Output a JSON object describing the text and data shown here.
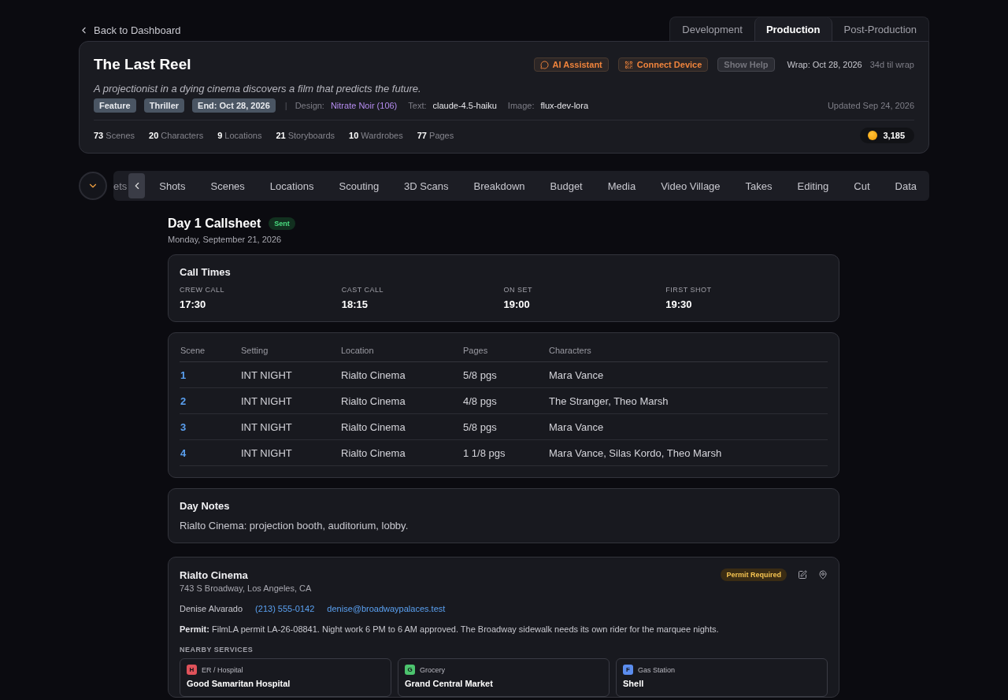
{
  "back_link": "Back to Dashboard",
  "stage_tabs": [
    {
      "label": "Development",
      "selected": false
    },
    {
      "label": "Production",
      "selected": true
    },
    {
      "label": "Post-Production",
      "selected": false
    }
  ],
  "project": {
    "title": "The Last Reel",
    "logline": "A projectionist in a dying cinema discovers a film that predicts the future.",
    "actions": [
      {
        "label": "AI Assistant",
        "kind": "ai",
        "disabled": false
      },
      {
        "label": "Connect Device",
        "kind": "device",
        "disabled": false
      },
      {
        "label": "Show Help",
        "kind": "help",
        "disabled": true
      }
    ],
    "wrap": "Wrap: Oct 28, 2026",
    "countdown": "34d til wrap",
    "tags": [
      "Feature",
      "Thriller",
      "End: Oct 28, 2026"
    ],
    "separator": "|",
    "meta": [
      {
        "label": "Design:",
        "value": "Nitrate Noir (106)",
        "kind": "accent"
      },
      {
        "label": "Text:",
        "value": "claude-4.5-haiku",
        "kind": "plain"
      },
      {
        "label": "Image:",
        "value": "flux-dev-lora",
        "kind": "plain"
      }
    ],
    "updated": "Updated Sep 24, 2026",
    "stats": [
      {
        "count": "73",
        "label": "Scenes"
      },
      {
        "count": "20",
        "label": "Characters"
      },
      {
        "count": "9",
        "label": "Locations"
      },
      {
        "count": "21",
        "label": "Storyboards"
      },
      {
        "count": "10",
        "label": "Wardrobes"
      },
      {
        "count": "77",
        "label": "Pages"
      }
    ],
    "credits": "3,185"
  },
  "nav_tabs": [
    "ets",
    "Shots",
    "Scenes",
    "Locations",
    "Scouting",
    "3D Scans",
    "Breakdown",
    "Budget",
    "Media",
    "Video Village",
    "Takes",
    "Editing",
    "Cut",
    "Data"
  ],
  "callsheet": {
    "title": "Day 1 Callsheet",
    "status": "Sent",
    "date": "Monday, September 21, 2026",
    "call_times": {
      "title": "Call Times",
      "items": [
        {
          "label": "CREW CALL",
          "time": "17:30"
        },
        {
          "label": "CAST CALL",
          "time": "18:15"
        },
        {
          "label": "ON SET",
          "time": "19:00"
        },
        {
          "label": "FIRST SHOT",
          "time": "19:30"
        }
      ]
    },
    "scenes": {
      "columns": [
        "Scene",
        "Setting",
        "Location",
        "Pages",
        "Characters"
      ],
      "rows": [
        [
          "1",
          "INT NIGHT",
          "Rialto Cinema",
          "5/8 pgs",
          "Mara Vance"
        ],
        [
          "2",
          "INT NIGHT",
          "Rialto Cinema",
          "4/8 pgs",
          "The Stranger, Theo Marsh"
        ],
        [
          "3",
          "INT NIGHT",
          "Rialto Cinema",
          "5/8 pgs",
          "Mara Vance"
        ],
        [
          "4",
          "INT NIGHT",
          "Rialto Cinema",
          "1 1/8 pgs",
          "Mara Vance, Silas Kordo, Theo Marsh"
        ]
      ]
    },
    "day_notes": {
      "title": "Day Notes",
      "text": "Rialto Cinema: projection booth, auditorium, lobby."
    },
    "location": {
      "name": "Rialto Cinema",
      "address": "743 S Broadway, Los Angeles, CA",
      "badge": "Permit Required",
      "contact": "Denise Alvarado",
      "phone": "(213) 555-0142",
      "email": "denise@broadwaypalaces.test",
      "permit": "**Permit:** FilmLA permit LA-26-08841. Night work 6 PM to 6 AM approved. The Broadway sidewalk needs its own rider for the marquee nights.",
      "services_title": "NEARBY SERVICES",
      "services": [
        {
          "letter": "H",
          "type": "ER / Hospital",
          "name": "Good Samaritan Hospital",
          "color": "#e0525a"
        },
        {
          "letter": "G",
          "type": "Grocery",
          "name": "Grand Central Market",
          "color": "#4cc46e"
        },
        {
          "letter": "F",
          "type": "Gas Station",
          "name": "Shell",
          "color": "#5b8def"
        }
      ]
    }
  }
}
